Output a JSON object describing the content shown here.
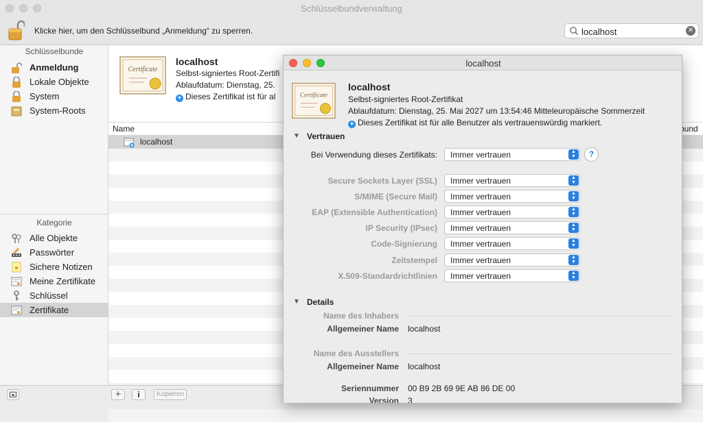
{
  "window": {
    "title": "Schlüsselbundverwaltung"
  },
  "toolbar": {
    "lock_text": "Klicke hier, um den Schlüsselbund „Anmeldung“ zu sperren."
  },
  "search": {
    "value": "localhost"
  },
  "sidebar": {
    "keychains_header": "Schlüsselbunde",
    "keychains": [
      {
        "label": "Anmeldung"
      },
      {
        "label": "Lokale Objekte"
      },
      {
        "label": "System"
      },
      {
        "label": "System-Roots"
      }
    ],
    "category_header": "Kategorie",
    "categories": [
      {
        "label": "Alle Objekte"
      },
      {
        "label": "Passwörter"
      },
      {
        "label": "Sichere Notizen"
      },
      {
        "label": "Meine Zertifikate"
      },
      {
        "label": "Schlüssel"
      },
      {
        "label": "Zertifikate"
      }
    ]
  },
  "cert_header": {
    "title": "localhost",
    "subtitle": "Selbst-signiertes Root-Zertifi",
    "expiry": "Ablaufdatum: Dienstag, 25.",
    "trust": "Dieses Zertifikat ist für al"
  },
  "list": {
    "col_name": "Name",
    "col_right": "bund",
    "rows": [
      {
        "name": "localhost"
      }
    ]
  },
  "bottom": {
    "copy_label": "Kopieren"
  },
  "dialog": {
    "title": "localhost",
    "cert_title": "localhost",
    "cert_type": "Selbst-signiertes Root-Zertifikat",
    "expiry": "Ablaufdatum: Dienstag, 25. Mai 2027 um 13:54:46 Mitteleuropäische Sommerzeit",
    "trust_note": "Dieses Zertifikat ist für alle Benutzer als vertrauenswürdig markiert.",
    "trust_section": "Vertrauen",
    "when_using_label": "Bei Verwendung dieses Zertifikats:",
    "when_using_value": "Immer vertrauen",
    "policies": [
      {
        "label": "Secure Sockets Layer (SSL)",
        "value": "Immer vertrauen"
      },
      {
        "label": "S/MIME (Secure Mail)",
        "value": "Immer vertrauen"
      },
      {
        "label": "EAP (Extensible Authentication)",
        "value": "Immer vertrauen"
      },
      {
        "label": "IP Security (IPsec)",
        "value": "Immer vertrauen"
      },
      {
        "label": "Code-Signierung",
        "value": "Immer vertrauen"
      },
      {
        "label": "Zeitstempel",
        "value": "Immer vertrauen"
      },
      {
        "label": "X.509-Standardrichtlinien",
        "value": "Immer vertrauen"
      }
    ],
    "details_section": "Details",
    "subject_group": "Name des Inhabers",
    "subject_cn_label": "Allgemeiner Name",
    "subject_cn_value": "localhost",
    "issuer_group": "Name des Ausstellers",
    "issuer_cn_label": "Allgemeiner Name",
    "issuer_cn_value": "localhost",
    "serial_label": "Seriennummer",
    "serial_value": "00 B9 2B 69 9E AB 86 DE 00",
    "version_label": "Version",
    "version_value": "3"
  },
  "colors": {
    "accent": "#2b7fe0",
    "close": "#fc5f57",
    "minimize": "#fdbc2e",
    "zoom": "#28c840"
  },
  "cert_image_text": "Certificate"
}
